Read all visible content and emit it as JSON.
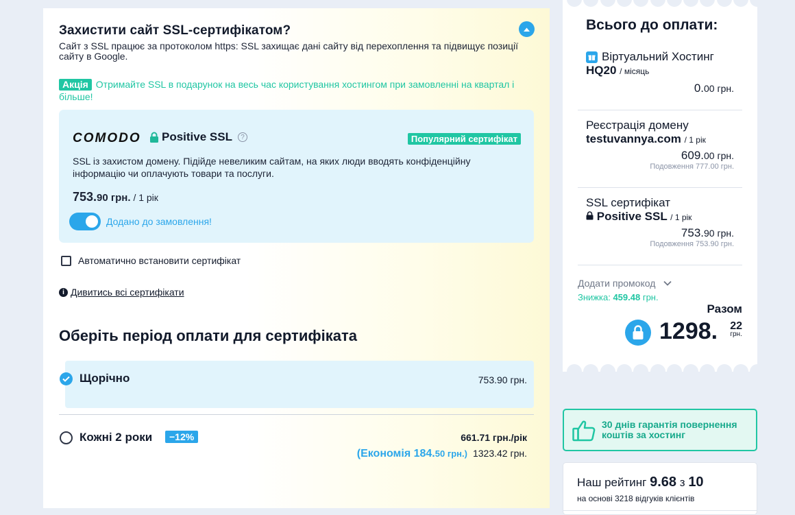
{
  "ssl_section": {
    "title": "Захистити сайт SSL-сертифікатом?",
    "description": "Сайт з SSL працює за протоколом https: SSL захищає дані сайту від перехоплення та підвищує позиції сайту в Google.",
    "promo_badge": "Акція",
    "promo_text": "Отримайте SSL в подарунок на весь час користування хостингом при замовленні на квартал і більше!",
    "cert": {
      "brand": "COMODO",
      "name": "Positive SSL",
      "popular_badge": "Популярний сертифікат",
      "description": "SSL із захистом домену. Підійде невеликим сайтам, на яких люди вводять конфіденційну інформацію чи оплачують товари та послуги.",
      "price_main": "753.",
      "price_cents": "90 грн.",
      "price_period": "/ 1 рік",
      "added_label": "Додано до замовлення!",
      "added": true
    },
    "auto_install_label": "Автоматично встановити сертифікат",
    "auto_install_checked": false,
    "all_certs_link": "Дивитись всі сертифікати"
  },
  "period": {
    "title": "Оберіть період оплати для сертифіката",
    "options": [
      {
        "label": "Щорічно",
        "price": "753.90 грн.",
        "selected": true
      },
      {
        "label": "Кожні 2 роки",
        "discount": "−12%",
        "per_year": "661.71 грн./рік",
        "economy_main": "(Економія 184.",
        "economy_small": "50 грн.)",
        "total": "1323.42 грн.",
        "selected": false
      }
    ]
  },
  "summary": {
    "title": "Всього до оплати:",
    "items": [
      {
        "line1": "Віртуальний Хостинг",
        "line2": "HQ20",
        "period": "/ місяць",
        "amount_main": "0.",
        "amount_small": "00 грн.",
        "renew": ""
      },
      {
        "line1": "Реєстрація домену",
        "line2": "testuvannya.com",
        "period": "/ 1 рік",
        "amount_main": "609.",
        "amount_small": "00 грн.",
        "renew": "Подовження 777.00 грн."
      },
      {
        "line1": "SSL сертифікат",
        "line2": "Positive SSL",
        "period": "/ 1 рік",
        "amount_main": "753.",
        "amount_small": "90 грн.",
        "renew": "Подовження 753.90 грн."
      }
    ],
    "promo_code_label": "Додати промокод",
    "discount_label": "Знижка:",
    "discount_value": "459.48",
    "discount_currency": "грн.",
    "total_label": "Разом",
    "total_main": "1298.",
    "total_kop": "22",
    "total_currency": "грн."
  },
  "guarantee": {
    "text": "30 днів гарантія повернення коштів за хостинг"
  },
  "rating": {
    "prefix": "Наш рейтинг",
    "value": "9.68",
    "of": "з",
    "max": "10",
    "reviews": "на основі 3218 відгуків клієнтів"
  },
  "colors": {
    "accent_blue": "#2ba6ea",
    "accent_green": "#20c6a3",
    "card_bg": "#e1f4fc",
    "page_bg": "#e9eef6"
  },
  "icons": [
    "chevron-up-icon",
    "lock-icon",
    "help-icon",
    "info-icon",
    "check-icon",
    "gift-icon",
    "chevron-down-icon",
    "thumbs-up-icon"
  ]
}
